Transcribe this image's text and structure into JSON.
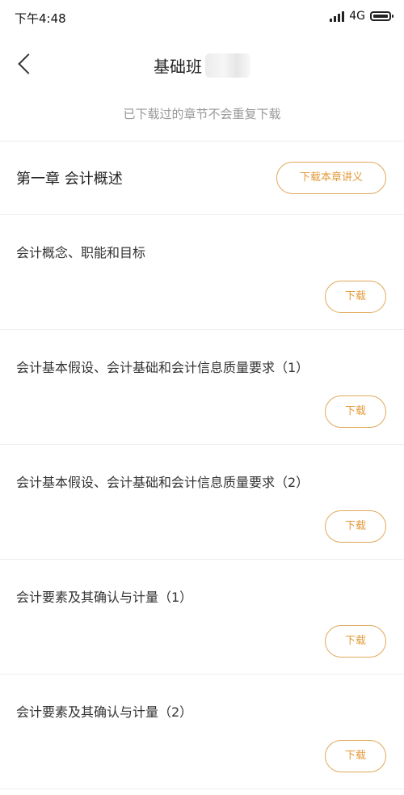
{
  "status_bar": {
    "time": "下午4:48",
    "network": "4G"
  },
  "nav": {
    "title": "基础班"
  },
  "notice": "已下载过的章节不会重复下载",
  "colors": {
    "accent": "#e39a3a",
    "accent_border": "#e0a95b",
    "notice_text": "#999999"
  },
  "chapter": {
    "title": "第一章 会计概述",
    "download_label": "下载本章讲义"
  },
  "sections": [
    {
      "title": "会计概念、职能和目标",
      "download_label": "下载"
    },
    {
      "title": "会计基本假设、会计基础和会计信息质量要求（1）",
      "download_label": "下载"
    },
    {
      "title": "会计基本假设、会计基础和会计信息质量要求（2）",
      "download_label": "下载"
    },
    {
      "title": "会计要素及其确认与计量（1）",
      "download_label": "下载"
    },
    {
      "title": "会计要素及其确认与计量（2）",
      "download_label": "下载"
    }
  ]
}
